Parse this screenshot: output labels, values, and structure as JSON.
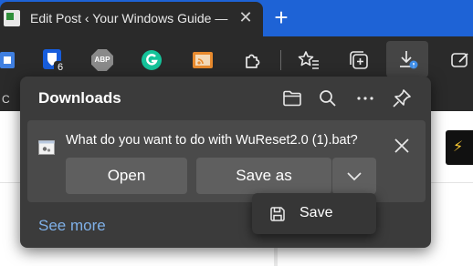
{
  "tab": {
    "title": "Edit Post ‹ Your Windows Guide —",
    "close": "✕",
    "new_tab": "+"
  },
  "toolbar": {
    "extension_badge_count": "6",
    "abp_label": "ABP",
    "bookmark_initial": "C"
  },
  "downloads": {
    "title": "Downloads",
    "item_prompt": "What do you want to do with WuReset2.0 (1).bat?",
    "open_label": "Open",
    "save_as_label": "Save as",
    "see_more_label": "See more"
  },
  "save_menu": {
    "save_label": "Save"
  },
  "colors": {
    "accent_blue": "#1e63d6",
    "link_blue": "#7fb0e8",
    "flyout_bg": "#3b3b3b",
    "item_bg": "#4a4a4a",
    "button_bg": "#5f5f5f"
  }
}
